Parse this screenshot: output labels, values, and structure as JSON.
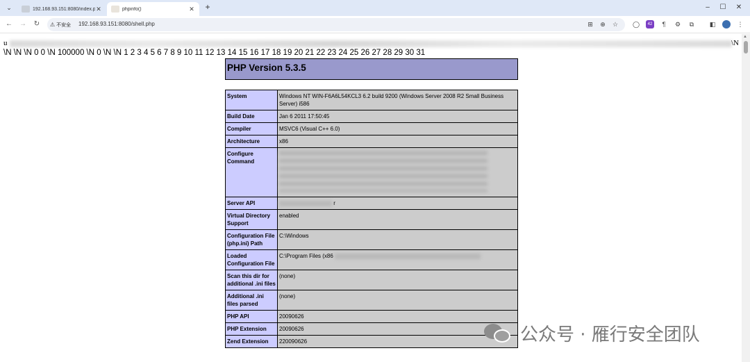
{
  "browser": {
    "tabs": [
      {
        "title": "192.168.93.151:8080/index.p",
        "active": false
      },
      {
        "title": "phpinfo()",
        "active": true
      }
    ],
    "new_tab": "+",
    "security_label": "不安全",
    "url": "192.168.93.151:8080/shell.php",
    "extension_badge": "42",
    "window_controls": {
      "minimize": "–",
      "maximize": "☐",
      "close": "✕"
    }
  },
  "page": {
    "dump_line1_start": "u",
    "dump_line1_end": "\\N",
    "dump_line2": "\\N \\N \\N 0 0 \\N 100000 \\N 0 \\N \\N 1 2 3 4 5 6 7 8 9 10 11 12 13 14 15 16 17 18 19 20 21 22 23 24 25 26 27 28 29 30 31",
    "php_version": "PHP Version 5.3.5",
    "rows": [
      {
        "key": "System",
        "value": "Windows NT WIN-F6A6L54KCL3 6.2 build 9200 (Windows Server 2008 R2 Small Business Server) i586"
      },
      {
        "key": "Build Date",
        "value": "Jan 6 2011 17:50:45"
      },
      {
        "key": "Compiler",
        "value": "MSVC6 (Visual C++ 6.0)"
      },
      {
        "key": "Architecture",
        "value": "x86"
      },
      {
        "key": "Configure Command",
        "value": ""
      },
      {
        "key": "Server API",
        "value": "r"
      },
      {
        "key": "Virtual Directory Support",
        "value": "enabled"
      },
      {
        "key": "Configuration File (php.ini) Path",
        "value": "C:\\Windows"
      },
      {
        "key": "Loaded Configuration File",
        "value": "C:\\Program Files (x86"
      },
      {
        "key": "Scan this dir for additional .ini files",
        "value": "(none)"
      },
      {
        "key": "Additional .ini files parsed",
        "value": "(none)"
      },
      {
        "key": "PHP API",
        "value": "20090626"
      },
      {
        "key": "PHP Extension",
        "value": "20090626"
      },
      {
        "key": "Zend Extension",
        "value": "220090626"
      }
    ]
  },
  "watermark": "公众号 · 雁行安全团队"
}
